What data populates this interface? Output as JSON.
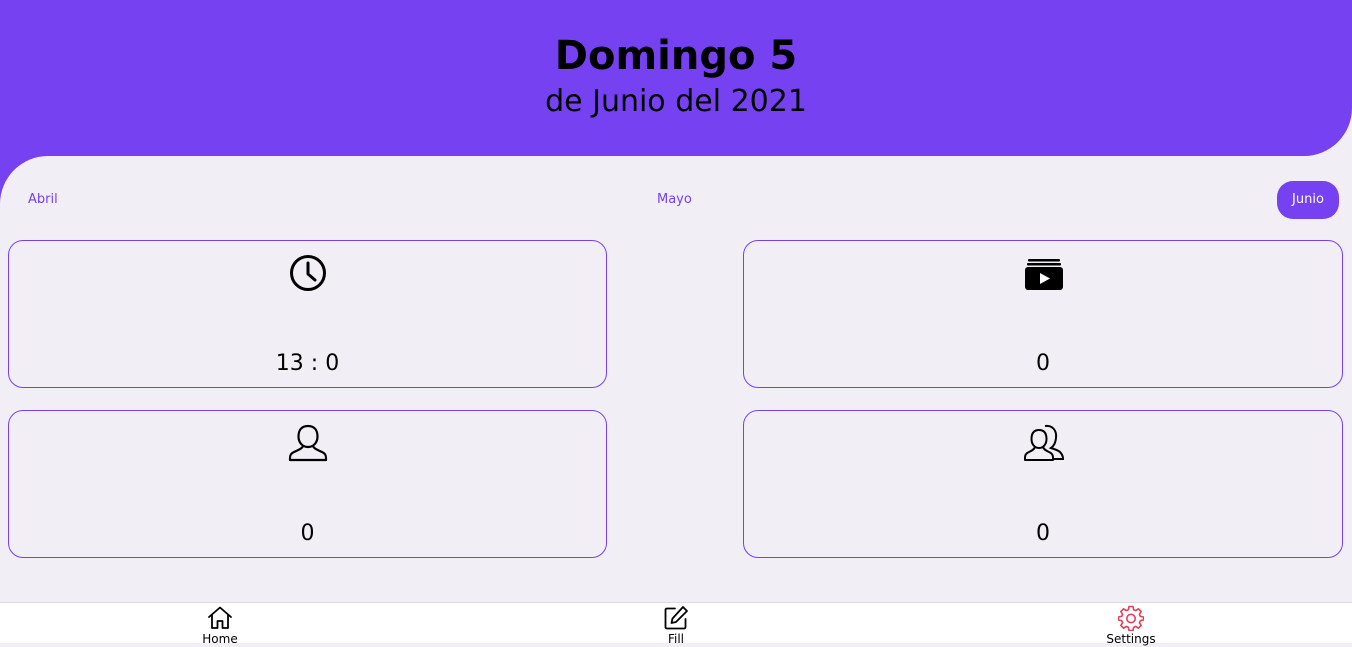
{
  "header": {
    "title": "Domingo 5",
    "subtitle": "de Junio del 2021"
  },
  "months": [
    {
      "label": "Abril",
      "active": false
    },
    {
      "label": "Mayo",
      "active": false
    },
    {
      "label": "Junio",
      "active": true
    }
  ],
  "stats": [
    {
      "icon": "clock-icon",
      "value": "13 : 0"
    },
    {
      "icon": "video-folder-icon",
      "value": "0"
    },
    {
      "icon": "user-icon",
      "value": "0"
    },
    {
      "icon": "users-icon",
      "value": "0"
    }
  ],
  "nav": [
    {
      "label": "Home",
      "icon": "home-icon"
    },
    {
      "label": "Fill",
      "icon": "edit-icon"
    },
    {
      "label": "Settings",
      "icon": "gear-icon"
    }
  ],
  "colors": {
    "accent": "#7641f0",
    "background": "#f1eff5",
    "settings_icon": "#e0405a"
  }
}
